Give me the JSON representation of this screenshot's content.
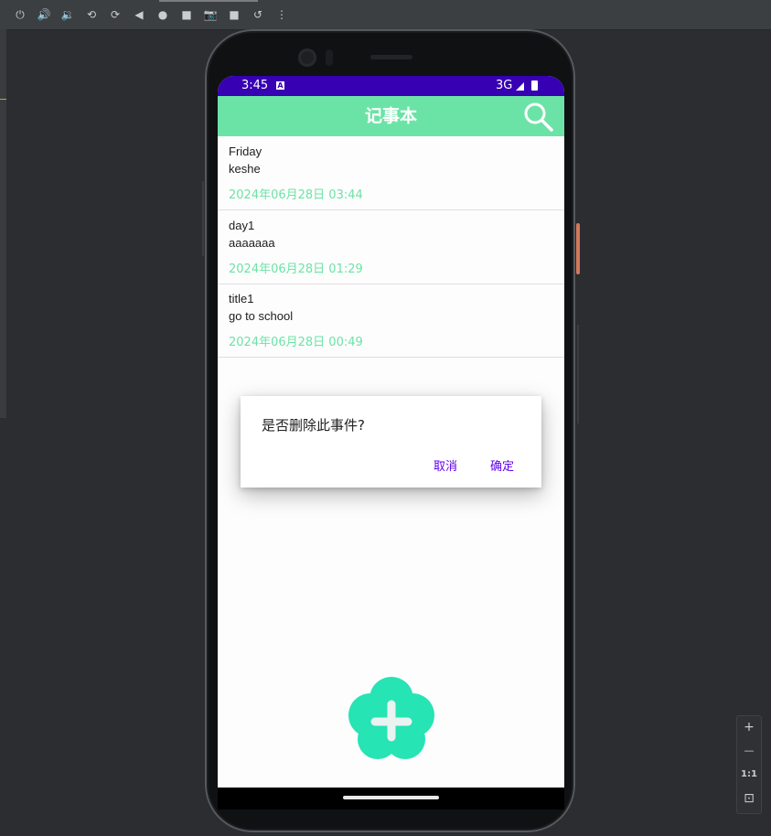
{
  "toolbar": {
    "icons": [
      "power-icon",
      "volume-up-icon",
      "volume-down-icon",
      "rotate-left-icon",
      "rotate-right-icon",
      "back-icon",
      "home-icon",
      "overview-icon",
      "camera-icon",
      "record-icon",
      "restore-icon",
      "more-icon"
    ],
    "glyphs": [
      "⏻",
      "🔊",
      "🔉",
      "⟲",
      "⟳",
      "◀",
      "●",
      "■",
      "📷",
      "■",
      "↺",
      "⋮"
    ]
  },
  "status": {
    "time": "3:45",
    "notif_glyph": "A",
    "network": "3G"
  },
  "app": {
    "title": "记事本"
  },
  "notes": [
    {
      "title": "Friday",
      "body": "keshe",
      "date": "2024年06月28日 03:44"
    },
    {
      "title": "day1",
      "body": "aaaaaaa",
      "date": "2024年06月28日 01:29"
    },
    {
      "title": "title1",
      "body": "go to school",
      "date": "2024年06月28日 00:49"
    }
  ],
  "dialog": {
    "message": "是否删除此事件?",
    "cancel": "取消",
    "confirm": "确定"
  },
  "zoom": {
    "zoom_in": "+",
    "zoom_out": "—",
    "actual_size": "1:1",
    "fit_glyph": "⊡"
  },
  "colors": {
    "accent_green": "#6ce3a6",
    "fab_green": "#26e4b4",
    "status_bar": "#3700b3",
    "dialog_button": "#6200ee"
  }
}
